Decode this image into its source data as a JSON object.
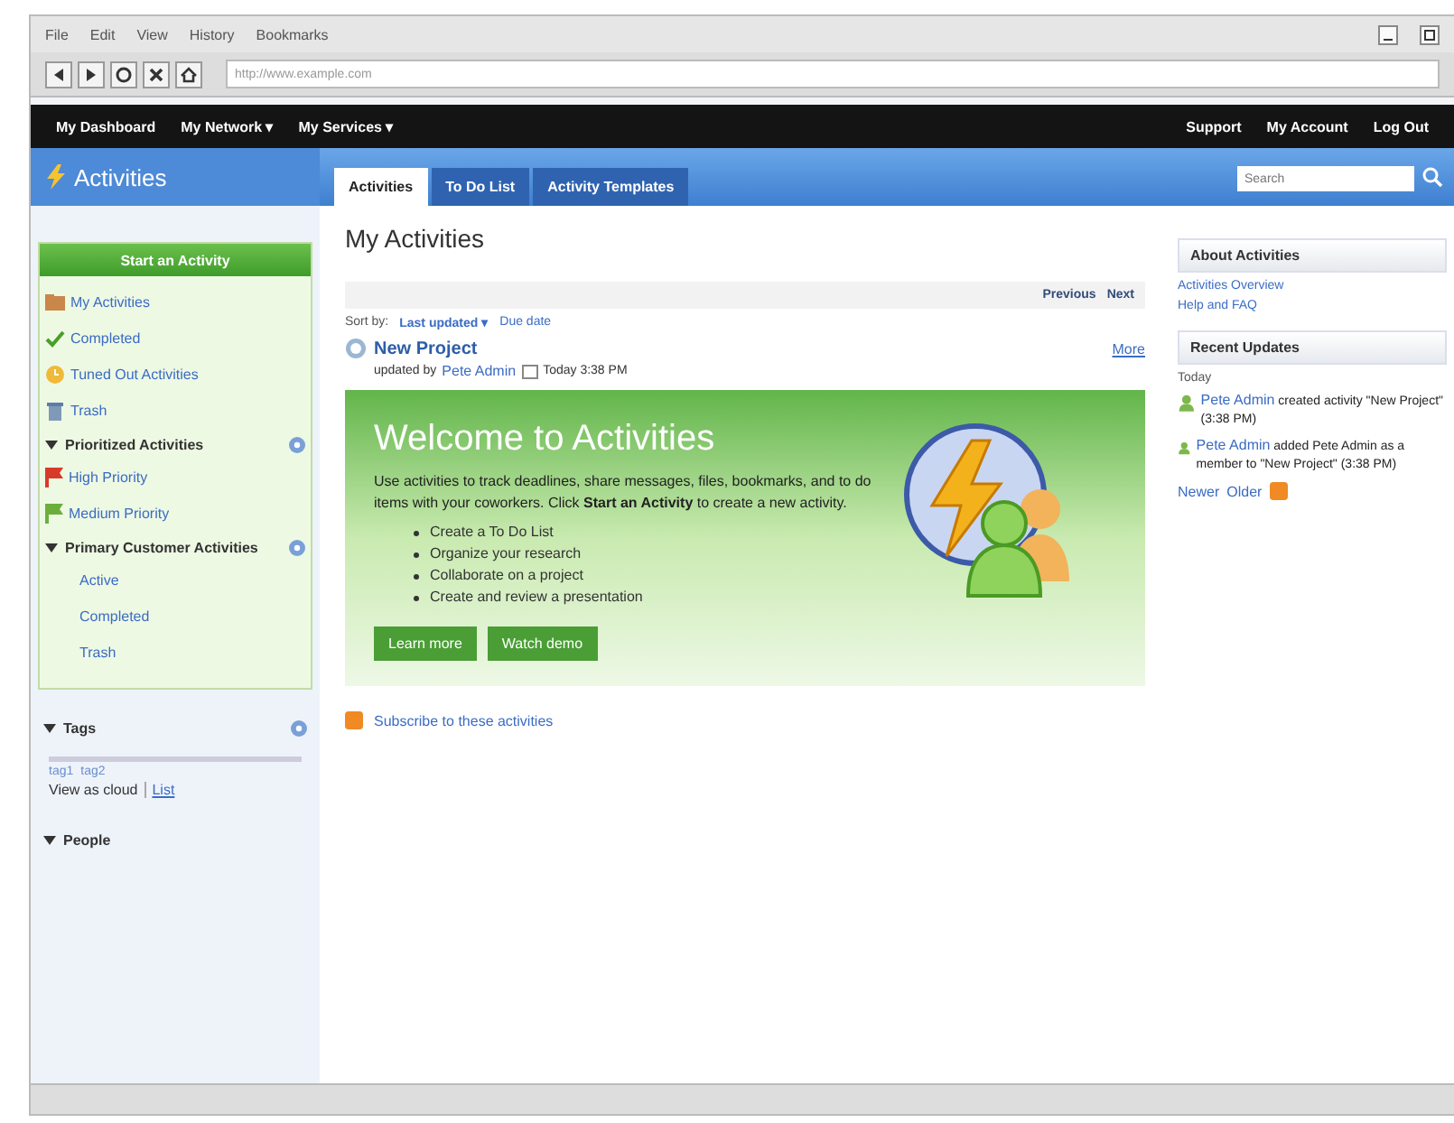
{
  "browser": {
    "menu": [
      "File",
      "Edit",
      "View",
      "History",
      "Bookmarks"
    ],
    "address": "http://www.example.com"
  },
  "nav": {
    "left": [
      "My Dashboard",
      "My Network ▾",
      "My Services ▾"
    ],
    "right": [
      "Support",
      "My Account",
      "Log Out"
    ]
  },
  "app_title": "Activities",
  "tabs": [
    {
      "label": "Activities",
      "selected": true
    },
    {
      "label": "To Do List",
      "selected": false
    },
    {
      "label": "Activity Templates",
      "selected": false
    }
  ],
  "search": {
    "placeholder": "Search"
  },
  "sidebar": {
    "start_button": "Start an Activity",
    "items": [
      {
        "label": "My Activities"
      },
      {
        "label": "Completed"
      },
      {
        "label": "Tuned Out Activities"
      },
      {
        "label": "Trash"
      }
    ],
    "sections": [
      {
        "title": "Prioritized Activities",
        "expanded": true,
        "items": [
          {
            "label": "High Priority",
            "color": "#d83a2a"
          },
          {
            "label": "Medium Priority",
            "color": "#6cae3c"
          }
        ]
      },
      {
        "title": "Primary Customer Activities",
        "expanded": true,
        "items": [
          {
            "label": "Active"
          },
          {
            "label": "Completed"
          },
          {
            "label": "Trash"
          }
        ]
      }
    ],
    "tags": {
      "title": "Tags",
      "expanded": true,
      "cloud": [
        "tag1",
        "tag2"
      ],
      "view_as": "View as cloud",
      "view_link": "List"
    },
    "people": {
      "title": "People",
      "expanded": true
    }
  },
  "main": {
    "title": "My Activities",
    "pager": [
      "Previous",
      "Next"
    ],
    "sort_label": "Sort by:",
    "sort_options": [
      {
        "label": "Last updated ▾",
        "selected": true
      },
      {
        "label": "Due date",
        "selected": false
      }
    ],
    "activity": {
      "title": "New Project",
      "updated_by": "updated by",
      "author": "Pete Admin",
      "time": "Today 3:38 PM",
      "more": "More"
    },
    "welcome": {
      "title": "Welcome to Activities",
      "text": "Use activities to track deadlines, share messages, files, bookmarks, and to do items with your coworkers. Click **Start an Activity** to create a new activity.",
      "bullets": [
        "Create a To Do List",
        "Organize your research",
        "Collaborate on a project",
        "Create and review a presentation"
      ],
      "buttons": [
        "Learn more",
        "Watch demo"
      ]
    },
    "subscribe": "Subscribe to these activities"
  },
  "right": {
    "about_title": "About Activities",
    "links": [
      "Activities Overview",
      "Help and FAQ"
    ],
    "updates_title": "Recent Updates",
    "day": "Today",
    "updates": [
      {
        "actor": "Pete Admin",
        "text": "created activity \"New Project\" (3:38 PM)"
      },
      {
        "actor": "Pete Admin",
        "text": "added Pete Admin as a member to \"New Project\" (3:38 PM)"
      }
    ],
    "pager": [
      "Newer",
      "Older"
    ]
  }
}
